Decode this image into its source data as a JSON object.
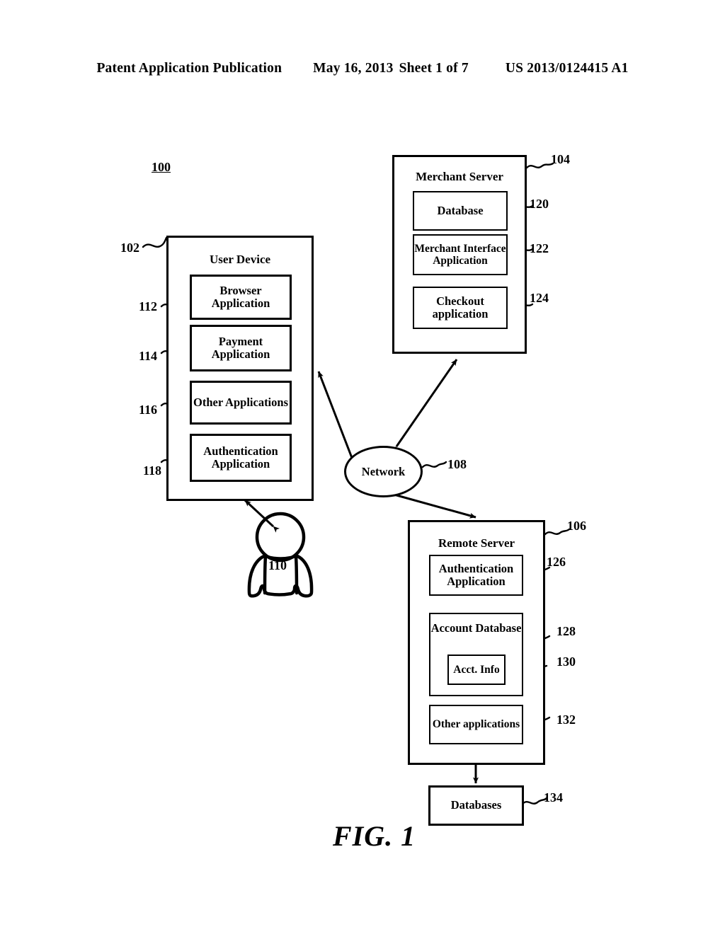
{
  "header": {
    "publication": "Patent Application Publication",
    "date": "May 16, 2013",
    "sheet": "Sheet 1 of 7",
    "patent_number": "US 2013/0124415 A1"
  },
  "figure": {
    "caption": "FIG. 1",
    "system_ref": "100"
  },
  "nodes": {
    "user_device": {
      "title": "User Device",
      "ref": "102",
      "components": [
        {
          "label": "Browser\nApplication",
          "ref": "112"
        },
        {
          "label": "Payment\nApplication",
          "ref": "114"
        },
        {
          "label": "Other Applications",
          "ref": "116"
        },
        {
          "label": "Authentication\nApplication",
          "ref": "118"
        }
      ]
    },
    "merchant_server": {
      "title": "Merchant Server",
      "ref": "104",
      "components": [
        {
          "label": "Database",
          "ref": "120"
        },
        {
          "label": "Merchant Interface\nApplication",
          "ref": "122"
        },
        {
          "label": "Checkout\napplication",
          "ref": "124"
        }
      ]
    },
    "remote_server": {
      "title": "Remote Server",
      "ref": "106",
      "components": [
        {
          "label": "Authentication\nApplication",
          "ref": "126"
        },
        {
          "label": "Account Database",
          "ref": "128"
        },
        {
          "label": "Acct. Info",
          "ref": "130"
        },
        {
          "label": "Other applications",
          "ref": "132"
        }
      ]
    },
    "network": {
      "label": "Network",
      "ref": "108"
    },
    "user": {
      "ref": "110"
    },
    "databases": {
      "label": "Databases",
      "ref": "134"
    }
  },
  "labels": {
    "browser_application": "Browser Application",
    "payment_application": "Payment Application",
    "other_applications": "Other Applications",
    "authentication_application": "Authentication Application",
    "database": "Database",
    "merchant_interface_application": "Merchant Interface Application",
    "checkout_application": "Checkout application",
    "account_database": "Account Database",
    "acct_info": "Acct. Info",
    "other_applications_lower": "Other applications",
    "databases": "Databases",
    "browser_line1": "Browser",
    "browser_line2": "Application",
    "payment_line1": "Payment",
    "payment_line2": "Application",
    "auth_line1": "Authentication",
    "auth_line2": "Application",
    "merchant_iface_line1": "Merchant Interface",
    "merchant_iface_line2": "Application",
    "checkout_line1": "Checkout",
    "checkout_line2": "application"
  },
  "colors": {
    "ink": "#000000",
    "paper": "#ffffff"
  }
}
